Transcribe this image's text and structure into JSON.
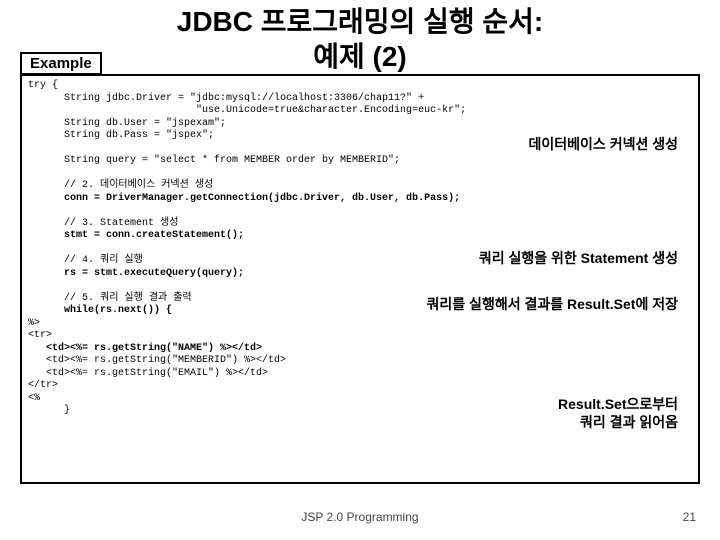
{
  "title_line1": "JDBC 프로그래밍의 실행 순서:",
  "title_line2": "예제 (2)",
  "example_label": "Example",
  "code": {
    "l01": "try {",
    "l02": "      String jdbc.Driver = \"jdbc:mysql://localhost:3306/chap11?\" +",
    "l03": "                            \"use.Unicode=true&character.Encoding=euc-kr\";",
    "l04": "      String db.User = \"jspexam\";",
    "l05": "      String db.Pass = \"jspex\";",
    "l06": "",
    "l07": "      String query = \"select * from MEMBER order by MEMBERID\";",
    "l08": "",
    "l09": "      // 2. 데이터베이스 커넥션 생성",
    "l10": "      conn = DriverManager.getConnection(jdbc.Driver, db.User, db.Pass);",
    "l11": "",
    "l12": "      // 3. Statement 생성",
    "l13": "      stmt = conn.createStatement();",
    "l14": "",
    "l15": "      // 4. 쿼리 실행",
    "l16": "      rs = stmt.executeQuery(query);",
    "l17": "",
    "l18": "      // 5. 쿼리 실행 결과 출력",
    "l19": "      while(rs.next()) {",
    "l20": "%>",
    "l21": "<tr>",
    "l22": "   <td><%= rs.getString(\"NAME\") %></td>",
    "l23": "   <td><%= rs.getString(\"MEMBERID\") %></td>",
    "l24": "   <td><%= rs.getString(\"EMAIL\") %></td>",
    "l25": "</tr>",
    "l26": "<%",
    "l27": "      }"
  },
  "annot1": "데이터베이스 커넥션 생성",
  "annot2": "쿼리 실행을 위한 Statement 생성",
  "annot3": "쿼리를 실행해서 결과를 Result.Set에 저장",
  "annot4a": "Result.Set으로부터",
  "annot4b": "쿼리 결과 읽어옴",
  "footer": "JSP 2.0 Programming",
  "page": "21"
}
